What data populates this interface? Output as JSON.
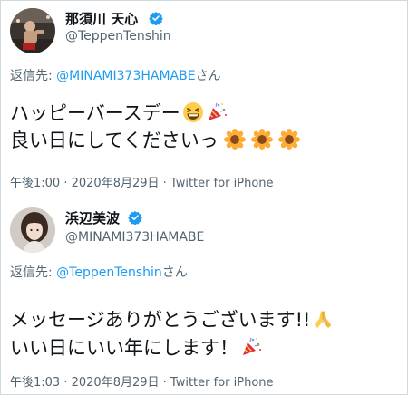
{
  "tweets": [
    {
      "display_name": "那須川 天心",
      "handle": "@TeppenTenshin",
      "reply_prefix": "返信先: ",
      "reply_to": "@MINAMI373HAMABE",
      "reply_suffix": "さん",
      "line1": "ハッピーバースデー",
      "line2": "良い日にしてくださいっ",
      "time": "午後1:00",
      "sep": " · ",
      "date": "2020年8月29日",
      "source": "Twitter for iPhone"
    },
    {
      "display_name": "浜辺美波",
      "handle": "@MINAMI373HAMABE",
      "reply_prefix": "返信先: ",
      "reply_to": "@TeppenTenshin",
      "reply_suffix": "さん",
      "line1": "メッセージありがとうございます!!",
      "line2": "いい日にいい年にします！",
      "time": "午後1:03",
      "sep": " · ",
      "date": "2020年8月29日",
      "source": "Twitter for iPhone"
    }
  ],
  "icons": {
    "verified": "verified-badge-icon",
    "grin": "grinning-squinting-face-icon",
    "popper": "party-popper-icon",
    "sunflower": "sunflower-icon",
    "pray": "folded-hands-icon"
  },
  "colors": {
    "link": "#1d9bf0",
    "secondary_text": "#536471",
    "verified": "#1d9bf0"
  }
}
